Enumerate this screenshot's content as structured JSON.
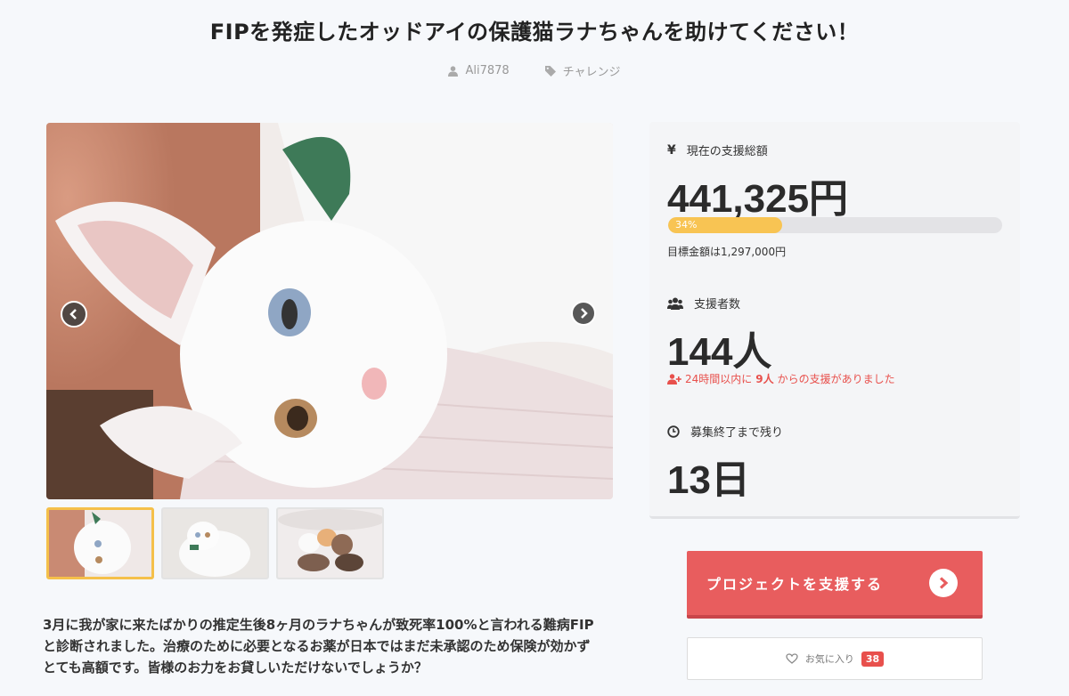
{
  "title": "FIPを発症したオッドアイの保護猫ラナちゃんを助けてください！",
  "meta": {
    "author": "Ali7878",
    "category": "チャレンジ"
  },
  "description": {
    "line1": "3月に我が家に来たばかりの推定生後8ヶ月のラナちゃんが致死率100%と言われる難病FIP",
    "line2": "と診断されました。治療のために必要となるお薬が日本ではまだ未承認のため保険が効かず",
    "line3": "とても高額です。皆様のお力をお貸しいただけないでしょうか？"
  },
  "stats": {
    "total_label": "現在の支援総額",
    "total_value": "441,325円",
    "progress_text": "34%",
    "progress": 0.34,
    "goal_text": "目標金額は1,297,000円",
    "supporters_label": "支援者数",
    "supporters_value": "144人",
    "recent_prefix": "24時間以内に",
    "recent_count": "9人",
    "recent_suffix": "からの支援がありました",
    "remaining_label": "募集終了まで残り",
    "remaining_value": "13日"
  },
  "actions": {
    "support_label": "プロジェクトを支援する",
    "favorite_label": "お気に入り",
    "favorite_count": "38"
  },
  "icons": {
    "author": "user-icon",
    "category": "tag-icon",
    "total": "yen-icon",
    "supporters": "users-icon",
    "recent": "user-plus-icon",
    "remaining": "clock-icon",
    "favorite": "heart-icon"
  },
  "colors": {
    "accent_red": "#e85d5e",
    "progress_yellow": "#f8c453",
    "recent_red": "#e8504c",
    "thumb_active": "#f5c04a"
  }
}
